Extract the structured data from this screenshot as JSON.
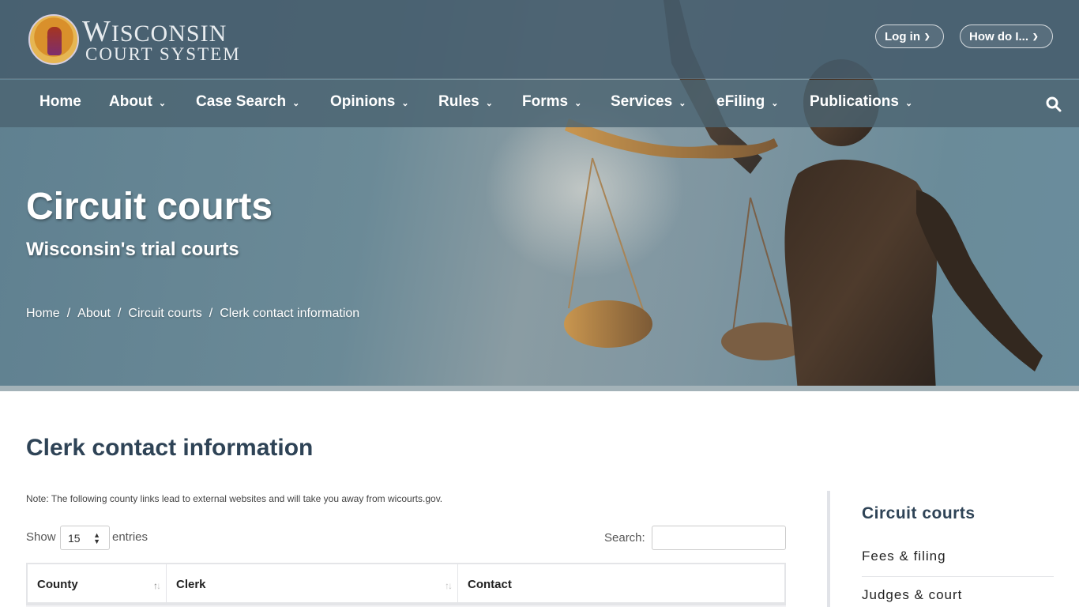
{
  "header": {
    "logo": {
      "line1": "Wisconsin",
      "line2": "Court System",
      "seal_icon": "court-seal-icon"
    },
    "login_label": "Log in",
    "howdo_label": "How do I...",
    "nav": [
      {
        "label": "Home",
        "has_dropdown": false
      },
      {
        "label": "About",
        "has_dropdown": true
      },
      {
        "label": "Case Search",
        "has_dropdown": true
      },
      {
        "label": "Opinions",
        "has_dropdown": true
      },
      {
        "label": "Rules",
        "has_dropdown": true
      },
      {
        "label": "Forms",
        "has_dropdown": true
      },
      {
        "label": "Services",
        "has_dropdown": true
      },
      {
        "label": "eFiling",
        "has_dropdown": true
      },
      {
        "label": "Publications",
        "has_dropdown": true
      }
    ],
    "search_icon": "search-icon"
  },
  "hero": {
    "title": "Circuit courts",
    "subtitle": "Wisconsin's trial courts",
    "breadcrumb": [
      "Home",
      "About",
      "Circuit courts",
      "Clerk contact information"
    ],
    "separator": "/"
  },
  "main": {
    "heading": "Clerk contact information",
    "note": "Note: The following county links lead to external websites and will take you away from wicourts.gov.",
    "show_label": "Show",
    "entries_value": "15",
    "entries_label": "entries",
    "search_label": "Search:",
    "search_value": "",
    "table": {
      "columns": [
        {
          "label": "County",
          "sort": "ascending"
        },
        {
          "label": "Clerk",
          "sort": "none"
        },
        {
          "label": "Contact",
          "sort": null
        }
      ]
    }
  },
  "sidebar": {
    "title": "Circuit courts",
    "links": [
      "Fees & filing",
      "Judges & court"
    ]
  },
  "colors": {
    "heading": "#2e4356",
    "topbar": "#465c6c",
    "table_border": "#e4e5e8"
  }
}
